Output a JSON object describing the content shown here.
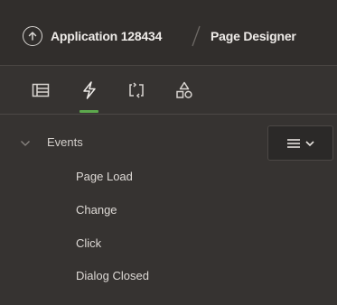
{
  "header": {
    "app_name": "Application 128434",
    "page_name": "Page Designer",
    "up_icon": "arrow-up-circle-icon"
  },
  "tabs": [
    {
      "icon": "rendering-tree-icon",
      "active": false
    },
    {
      "icon": "lightning-bolt-icon",
      "active": true
    },
    {
      "icon": "processing-cycle-icon",
      "active": false
    },
    {
      "icon": "shared-components-icon",
      "active": false
    }
  ],
  "tree": {
    "group_label": "Events",
    "items": [
      "Page Load",
      "Change",
      "Click",
      "Dialog Closed"
    ],
    "menu_icon": "hamburger-menu-icon"
  },
  "colors": {
    "background": "#363331",
    "header": "#312e2c",
    "accent": "#5da94d",
    "text": "#eeebe8"
  }
}
